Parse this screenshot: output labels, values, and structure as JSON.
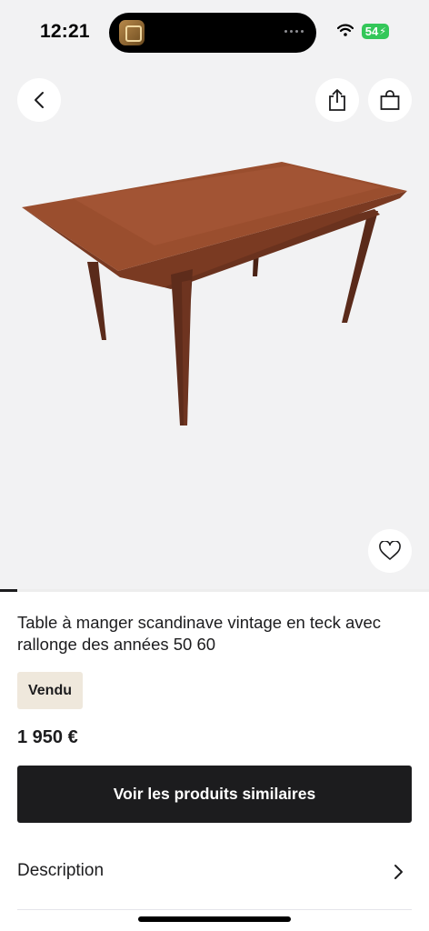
{
  "status_bar": {
    "time": "12:21",
    "battery_level": "54",
    "battery_color": "#34c759"
  },
  "header": {
    "back_icon": "chevron-left-icon",
    "share_icon": "share-icon",
    "bag_icon": "shopping-bag-icon"
  },
  "gallery": {
    "favorite_icon": "heart-outline-icon",
    "image_progress": 0.04
  },
  "product": {
    "title": "Table à manger scandinave vintage en teck avec rallonge des années 50 60",
    "status_badge": "Vendu",
    "price": "1 950 €",
    "similar_button_label": "Voir les produits similaires"
  },
  "sections": {
    "description_label": "Description"
  },
  "colors": {
    "primary_dark": "#1c1c1e",
    "badge_bg": "#efe8dc",
    "hero_bg": "#f2f2f3"
  }
}
